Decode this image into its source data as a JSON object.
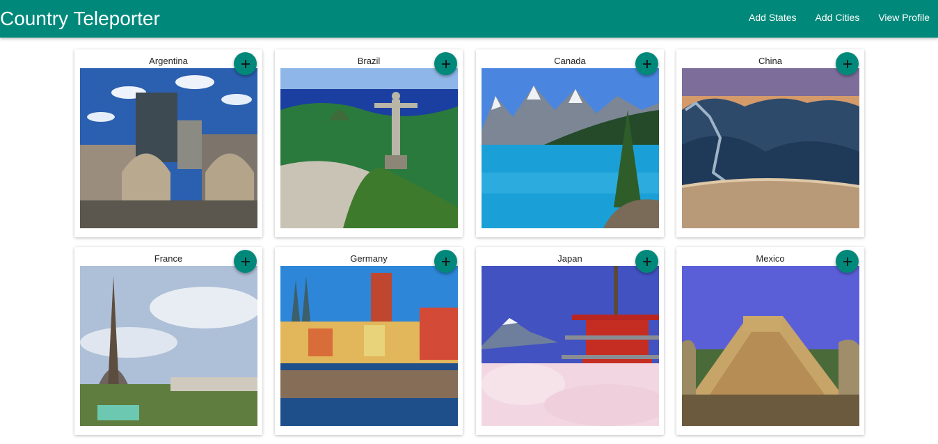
{
  "app": {
    "title": "Country Teleporter"
  },
  "nav": {
    "items": [
      {
        "label": "Add States"
      },
      {
        "label": "Add Cities"
      },
      {
        "label": "View Profile"
      }
    ]
  },
  "cards": [
    {
      "name": "Argentina"
    },
    {
      "name": "Brazil"
    },
    {
      "name": "Canada"
    },
    {
      "name": "China"
    },
    {
      "name": "France"
    },
    {
      "name": "Germany"
    },
    {
      "name": "Japan"
    },
    {
      "name": "Mexico"
    }
  ],
  "icons": {
    "add": "plus-icon"
  },
  "colors": {
    "accent": "#00897b"
  }
}
